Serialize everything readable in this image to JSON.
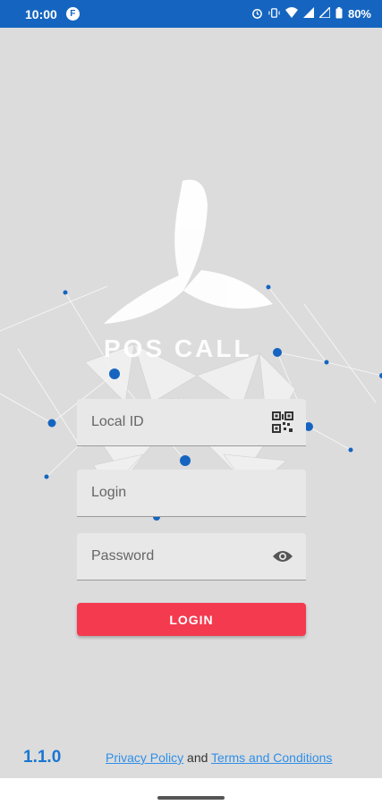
{
  "status_bar": {
    "time": "10:00",
    "app_badge": "F",
    "battery": "80%",
    "icons": [
      "alarm-icon",
      "vibrate-icon",
      "wifi-icon",
      "signal-icon",
      "signal-icon",
      "battery-icon"
    ]
  },
  "logo": {
    "text": "POS CALL"
  },
  "form": {
    "local_id": {
      "placeholder": "Local ID",
      "value": ""
    },
    "login": {
      "placeholder": "Login",
      "value": ""
    },
    "password": {
      "placeholder": "Password",
      "value": ""
    },
    "submit_label": "LOGIN"
  },
  "footer": {
    "version": "1.1.0",
    "privacy_label": "Privacy Policy",
    "and_text": "and",
    "terms_label": "Terms and Conditions"
  },
  "colors": {
    "status_bar": "#1565c0",
    "accent": "#f43a4f",
    "link": "#2f8fe8",
    "version": "#1976d2"
  }
}
